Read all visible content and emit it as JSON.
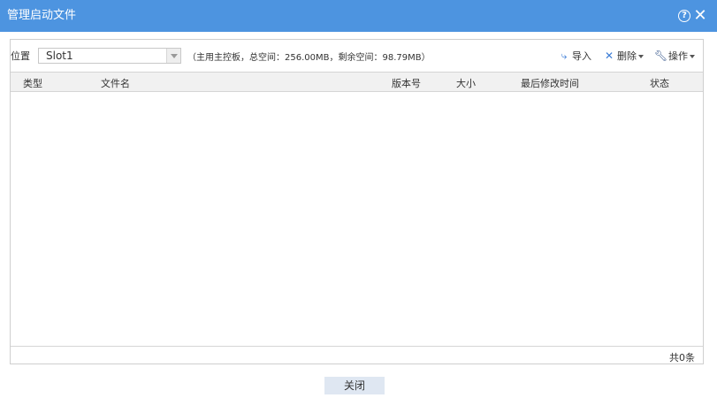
{
  "dialog": {
    "title": "管理启动文件",
    "help_glyph": "?",
    "close_glyph": "✕"
  },
  "toolbar": {
    "location_label": "位置",
    "location_value": "Slot1",
    "storage_info": "（主用主控板，总空间：256.00MB，剩余空间：98.79MB）",
    "import_label": "导入",
    "delete_label": "删除",
    "operate_label": "操作",
    "icons": {
      "import": "import-icon",
      "delete": "delete-x-icon",
      "operate": "wrench-icon"
    },
    "accent_color": "#3a7bd5"
  },
  "table": {
    "columns": [
      "类型",
      "文件名",
      "版本号",
      "大小",
      "最后修改时间",
      "状态"
    ],
    "rows": [],
    "total_text": "共0条"
  },
  "footer": {
    "close_label": "关闭"
  },
  "colors": {
    "titlebar": "#4d94e0",
    "header_bg": "#f1f1f1",
    "close_button_bg": "#dfe7f2"
  }
}
